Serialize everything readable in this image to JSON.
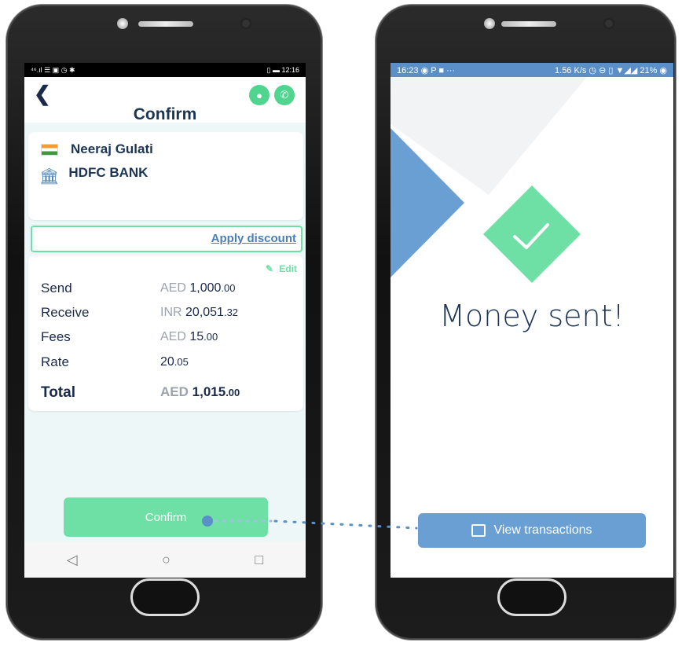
{
  "phone1": {
    "status": {
      "left": "⁴⁶.ıl ☰ ▣ ◷ ✱",
      "right": "▯ ▬ 12:16"
    },
    "header": {
      "back_icon": "chevron-left",
      "title": "Confirm"
    },
    "recipient": {
      "flag": "india-flag",
      "name": "Neeraj Gulati",
      "bank_icon": "bank-icon",
      "bank": "HDFC BANK"
    },
    "discount": {
      "link": "Apply discount"
    },
    "summary": {
      "edit_label": "Edit",
      "rows": [
        {
          "label": "Send",
          "currency": "AED",
          "amount": "1,000",
          "decimals": ".00"
        },
        {
          "label": "Receive",
          "currency": "INR",
          "amount": "20,051",
          "decimals": ".32"
        },
        {
          "label": "Fees",
          "currency": "AED",
          "amount": "15",
          "decimals": ".00"
        },
        {
          "label": "Rate",
          "currency": "",
          "amount": "20",
          "decimals": ".05"
        }
      ],
      "total": {
        "label": "Total",
        "currency": "AED",
        "amount": "1,015",
        "decimals": ".00"
      }
    },
    "confirm_button": "Confirm",
    "nav": {
      "back": "◁",
      "home": "○",
      "recent": "□"
    }
  },
  "phone2": {
    "status": {
      "left": "16:23 ◉ P ■ ···",
      "right": "1.56 K/s ◷ ⊖ ▯ ▼◢◢ 21% ◉"
    },
    "message": "Money sent!",
    "view_button": "View transactions"
  },
  "colors": {
    "accent_green": "#6ee0a5",
    "accent_blue": "#6a9fd3",
    "navy": "#1b3555"
  }
}
